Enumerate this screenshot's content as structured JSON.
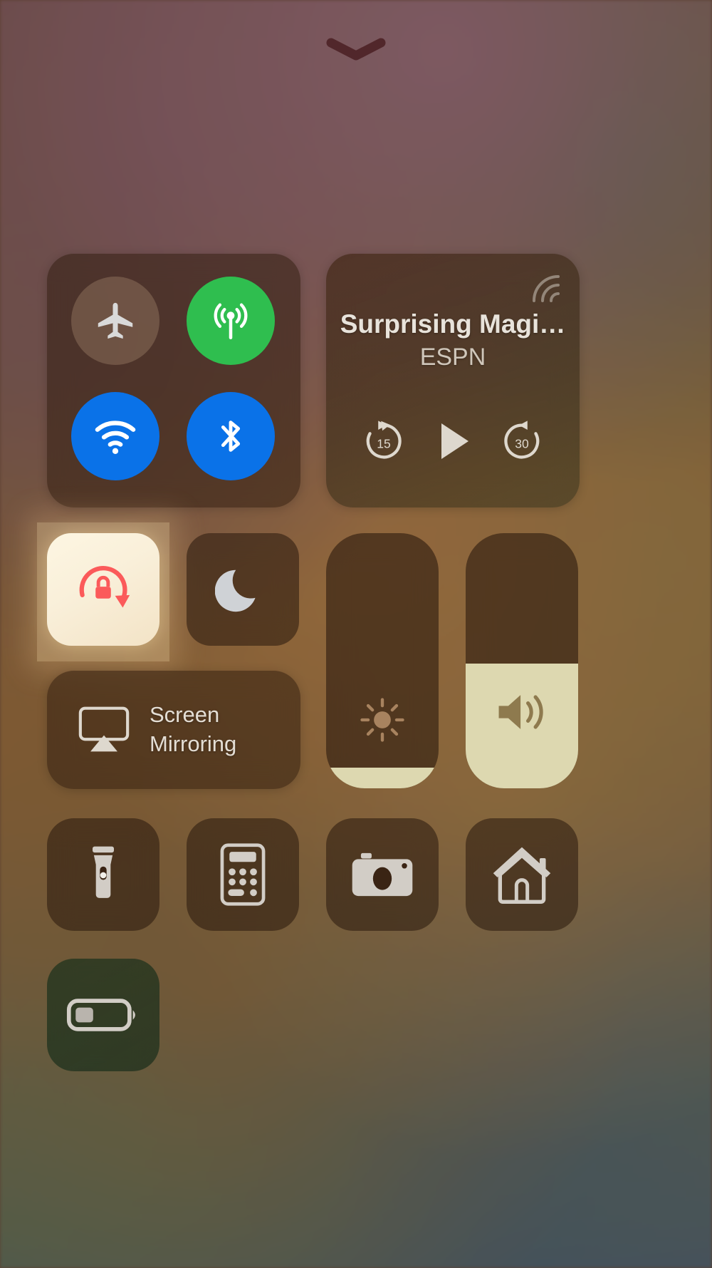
{
  "screen": {
    "name": "Control Center",
    "platform": "iOS",
    "handle_icon": "chevron-down-icon"
  },
  "connectivity": {
    "name": "Connectivity module",
    "buttons": [
      {
        "id": "airplane-mode",
        "label": "Airplane Mode",
        "icon": "airplane-icon",
        "state": "off",
        "color": "#bea082"
      },
      {
        "id": "cellular-data",
        "label": "Cellular Data",
        "icon": "cellular-icon",
        "state": "on",
        "color": "#2fbe4f"
      },
      {
        "id": "wifi",
        "label": "Wi-Fi",
        "icon": "wifi-icon",
        "state": "on",
        "color": "#0a72e8"
      },
      {
        "id": "bluetooth",
        "label": "Bluetooth",
        "icon": "bluetooth-icon",
        "state": "on",
        "color": "#0a72e8"
      }
    ]
  },
  "media": {
    "name": "Now Playing",
    "title": "Surprising Magi…",
    "subtitle": "ESPN",
    "airplay_icon": "airplay-audio-icon",
    "controls": [
      {
        "id": "skip-back",
        "label": "15",
        "icon": "skip-back-15-icon"
      },
      {
        "id": "play",
        "label": "Play",
        "icon": "play-icon"
      },
      {
        "id": "skip-forward",
        "label": "30",
        "icon": "skip-forward-30-icon"
      }
    ]
  },
  "toggles": {
    "rotation_lock": {
      "id": "rotation-lock",
      "label": "Portrait Orientation Lock",
      "icon": "rotation-lock-icon",
      "state": "on",
      "accent_color": "#fb5a5a",
      "selected": true
    },
    "do_not_disturb": {
      "id": "do-not-disturb",
      "label": "Do Not Disturb",
      "icon": "moon-icon",
      "state": "off"
    }
  },
  "screen_mirroring": {
    "id": "screen-mirroring",
    "label_line1": "Screen",
    "label_line2": "Mirroring",
    "icon": "airplay-screen-icon"
  },
  "sliders": [
    {
      "id": "brightness",
      "label": "Brightness",
      "icon": "sun-icon",
      "value_percent": 8,
      "fill_color": "#ddd8b0"
    },
    {
      "id": "volume",
      "label": "Volume",
      "icon": "speaker-icon",
      "value_percent": 49,
      "fill_color": "#ddd8b0"
    }
  ],
  "apps": [
    {
      "id": "flashlight",
      "label": "Flashlight",
      "icon": "flashlight-icon"
    },
    {
      "id": "calculator",
      "label": "Calculator",
      "icon": "calculator-icon"
    },
    {
      "id": "camera",
      "label": "Camera",
      "icon": "camera-icon"
    },
    {
      "id": "home",
      "label": "Home",
      "icon": "house-icon"
    }
  ],
  "battery": {
    "id": "low-power-mode",
    "label": "Low Power Mode",
    "icon": "battery-low-icon",
    "state": "off"
  }
}
